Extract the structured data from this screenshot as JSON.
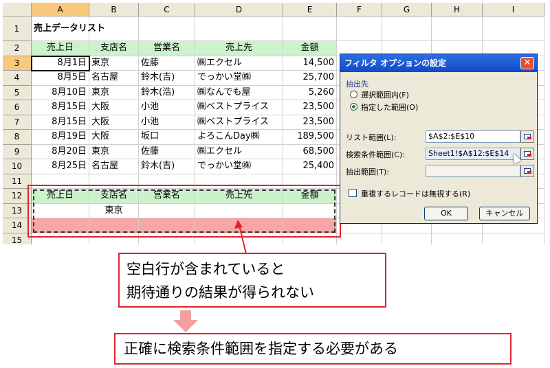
{
  "columns": [
    "A",
    "B",
    "C",
    "D",
    "E",
    "F",
    "G",
    "H",
    "I"
  ],
  "rows": [
    "1",
    "2",
    "3",
    "4",
    "5",
    "6",
    "7",
    "8",
    "9",
    "10",
    "11",
    "12",
    "13",
    "14",
    "15"
  ],
  "title": "売上データリスト",
  "headers": [
    "売上日",
    "支店名",
    "営業名",
    "売上先",
    "金額"
  ],
  "data_rows": [
    [
      "8月1日",
      "東京",
      "佐藤",
      "㈱エクセル",
      "14,500"
    ],
    [
      "8月5日",
      "名古屋",
      "鈴木(吉)",
      "でっかい堂㈱",
      "25,700"
    ],
    [
      "8月10日",
      "東京",
      "鈴木(浩)",
      "㈱なんでも屋",
      "5,260"
    ],
    [
      "8月15日",
      "大阪",
      "小池",
      "㈱ベストプライス",
      "23,500"
    ],
    [
      "8月15日",
      "大阪",
      "小池",
      "㈱ベストプライス",
      "23,500"
    ],
    [
      "8月19日",
      "大阪",
      "坂口",
      "よろこんDay㈱",
      "189,500"
    ],
    [
      "8月20日",
      "東京",
      "佐藤",
      "㈱エクセル",
      "68,500"
    ],
    [
      "8月25日",
      "名古屋",
      "鈴木(吉)",
      "でっかい堂㈱",
      "25,400"
    ]
  ],
  "criteria_headers": [
    "売上日",
    "支店名",
    "営業名",
    "売上先",
    "金額"
  ],
  "criteria_value": "東京",
  "dialog": {
    "title": "フィルタ オプションの設定",
    "close": "✕",
    "group_label": "抽出先",
    "radio1": "選択範囲内(F)",
    "radio2": "指定した範囲(O)",
    "list_range_label": "リスト範囲(L):",
    "list_range_value": "$A$2:$E$10",
    "criteria_range_label": "検索条件範囲(C):",
    "criteria_range_value": "Sheet1!$A$12:$E$14",
    "output_range_label": "抽出範囲(T):",
    "output_range_value": "",
    "unique_label": "重複するレコードは無視する(R)",
    "ok": "OK",
    "cancel": "キャンセル"
  },
  "callout1_line1": "空白行が含まれていると",
  "callout1_line2": "期待通りの結果が得られない",
  "callout2": "正確に検索条件範囲を指定する必要がある",
  "colors": {
    "header_green": "#ccf2cc",
    "pink_row": "#f6a6a6",
    "annotation_red": "#e0242a",
    "arrow_pink": "#f4a0a0"
  }
}
